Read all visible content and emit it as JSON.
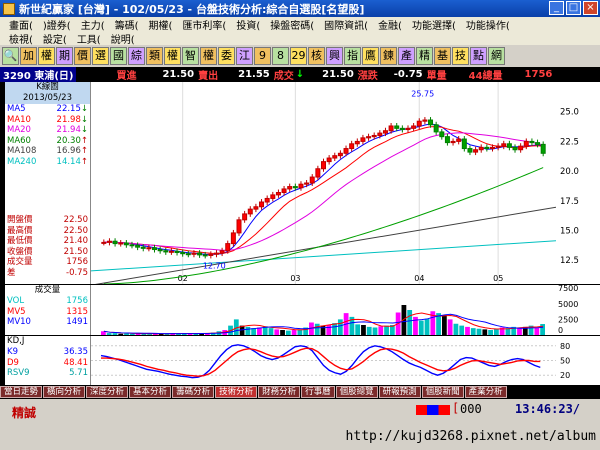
{
  "titlebar": {
    "title": "新世紀贏家 [台灣] - 102/05/23 - 台盤技術分析:綜合自選股[名望股]"
  },
  "menu": {
    "row1": [
      "畫面(",
      ")證券(",
      "主力(",
      "籌碼(",
      "期權(",
      "匯市利率(",
      "投資(",
      "操盤密碼(",
      "國際資訊(",
      "金融(",
      "功能選擇(",
      "功能操作("
    ],
    "row2": [
      "檢視(",
      "設定(",
      "工具(",
      "說明("
    ]
  },
  "toolbar": {
    "items": [
      "🔍",
      "加",
      "權",
      "期",
      "價",
      "選",
      "國",
      "綜",
      "類",
      "權",
      "智",
      "權",
      "委",
      "江",
      "9",
      "8",
      "29",
      "核",
      "興",
      "指",
      "鷹",
      "鍊",
      "產",
      "精",
      "基",
      "技",
      "點",
      "網"
    ]
  },
  "info": {
    "symbol": "3290 東浦(日)",
    "bid_label": "買進",
    "bid": "21.50",
    "ask_label": "賣出",
    "ask": "21.55",
    "deal_label": "成交",
    "deal": "21.50",
    "change_label": "漲跌",
    "change": "-0.75",
    "unit_label": "單量",
    "total_vol_label": "44總量",
    "total_vol": "1756"
  },
  "kpanel": {
    "header": "K線圖",
    "date": "2013/05/23",
    "ma": [
      {
        "name": "MA5",
        "value": "22.15",
        "arrow": "↓",
        "color": "#0000ff"
      },
      {
        "name": "MA10",
        "value": "21.98",
        "arrow": "↓",
        "color": "#ff0000"
      },
      {
        "name": "MA20",
        "value": "21.94",
        "arrow": "↓",
        "color": "#e000e0"
      },
      {
        "name": "MA60",
        "value": "20.30",
        "arrow": "↑",
        "color": "#008000"
      },
      {
        "name": "MA108",
        "value": "16.96",
        "arrow": "↑",
        "color": "#404040"
      },
      {
        "name": "MA240",
        "value": "14.14",
        "arrow": "↑",
        "color": "#00c0c0"
      }
    ],
    "prices": [
      {
        "name": "開盤價",
        "value": "22.50"
      },
      {
        "name": "最高價",
        "value": "22.50"
      },
      {
        "name": "最低價",
        "value": "21.40"
      },
      {
        "name": "收盤價",
        "value": "21.50"
      },
      {
        "name": "成交量",
        "value": "1756"
      },
      {
        "name": "差",
        "value": "-0.75"
      }
    ]
  },
  "volpanel": {
    "header": "成交量",
    "rows": [
      {
        "name": "VOL",
        "value": "1756",
        "color": "#00c0c0"
      },
      {
        "name": "MV5",
        "value": "1315",
        "color": "#ff0000"
      },
      {
        "name": "MV10",
        "value": "1491",
        "color": "#0000ff"
      }
    ]
  },
  "kdpanel": {
    "header": "KD,J",
    "rows": [
      {
        "name": "K9",
        "value": "36.35",
        "color": "#0000ff"
      },
      {
        "name": "D9",
        "value": "48.41",
        "color": "#ff0000"
      },
      {
        "name": "RSV9",
        "value": "5.71",
        "color": "#00a0a0"
      }
    ]
  },
  "chart_data": [
    {
      "type": "candlestick",
      "ylim": [
        10.5,
        27.5
      ],
      "y_ticks": [
        "25.0",
        "22.5",
        "20.0",
        "17.5",
        "15.0",
        "12.5"
      ],
      "x_labels": [
        "02",
        "03",
        "04",
        "05"
      ],
      "high_label": "25.75",
      "low_label": "12.70",
      "closes": [
        14,
        14.1,
        13.9,
        13.95,
        13.8,
        13.75,
        13.6,
        13.5,
        13.55,
        13.4,
        13.3,
        13.2,
        13.25,
        13.15,
        13.05,
        13.0,
        13.1,
        12.95,
        12.9,
        13.0,
        13.1,
        13.3,
        13.9,
        14.8,
        15.9,
        16.4,
        16.8,
        17.0,
        17.4,
        17.7,
        18.0,
        18.2,
        18.5,
        18.7,
        18.6,
        18.9,
        19.0,
        19.5,
        20.2,
        20.8,
        21.1,
        21.3,
        21.5,
        21.9,
        22.3,
        22.5,
        22.8,
        22.9,
        23.0,
        23.2,
        23.4,
        23.8,
        23.6,
        23.5,
        23.6,
        23.8,
        24.2,
        24.3,
        23.9,
        23.3,
        22.9,
        22.4,
        22.5,
        22.7,
        21.9,
        21.6,
        21.8,
        22.0,
        21.9,
        22.0,
        22.1,
        22.3,
        22.0,
        21.8,
        22.1,
        22.5,
        22.4,
        22.25,
        21.5
      ],
      "ma5": [],
      "ma20": [],
      "ma60_line": [
        10.5,
        20.3
      ],
      "ma108_line": [
        10.4,
        16.96
      ],
      "ma240_line": [
        11.6,
        14.14
      ]
    },
    {
      "type": "bar",
      "y_ticks": [
        "7500",
        "5000",
        "2500",
        "0"
      ],
      "ylim": [
        0,
        8000
      ],
      "values": [
        600,
        300,
        300,
        200,
        250,
        200,
        250,
        200,
        150,
        200,
        250,
        200,
        300,
        200,
        250,
        300,
        200,
        300,
        300,
        400,
        600,
        800,
        1500,
        2500,
        1500,
        1300,
        1100,
        1200,
        1400,
        1100,
        900,
        800,
        700,
        800,
        900,
        1200,
        2000,
        1800,
        1500,
        1600,
        1900,
        2500,
        3500,
        2900,
        1700,
        1600,
        1300,
        1200,
        1400,
        1500,
        1600,
        3600,
        4800,
        4000,
        2900,
        2300,
        2600,
        3800,
        3500,
        3200,
        2500,
        1800,
        1500,
        1300,
        1100,
        1000,
        900,
        800,
        1000,
        1200,
        1100,
        1300,
        1200,
        1300,
        1500,
        1200,
        1756
      ]
    },
    {
      "type": "line",
      "y_ticks": [
        "80",
        "50",
        "20"
      ],
      "ylim": [
        0,
        100
      ],
      "k": [
        60,
        58,
        55,
        52,
        48,
        44,
        40,
        36,
        32,
        30,
        28,
        25,
        22,
        20,
        18,
        17,
        15,
        16,
        20,
        30,
        45,
        60,
        72,
        80,
        82,
        80,
        75,
        68,
        60,
        55,
        52,
        55,
        62,
        70,
        78,
        80,
        78,
        70,
        55,
        40,
        30,
        25,
        22,
        28,
        40,
        55,
        68,
        76,
        80,
        78,
        74,
        68,
        60,
        52,
        45,
        40,
        36,
        30,
        24,
        20,
        24,
        32,
        42,
        52,
        56,
        55,
        50,
        45,
        40,
        38,
        42,
        48,
        52,
        54,
        52,
        46,
        40,
        36
      ],
      "d": [
        55,
        55,
        54,
        53,
        51,
        48,
        45,
        42,
        38,
        35,
        32,
        30,
        27,
        25,
        22,
        20,
        19,
        18,
        19,
        23,
        30,
        40,
        50,
        60,
        68,
        72,
        74,
        72,
        68,
        63,
        59,
        57,
        58,
        62,
        67,
        72,
        75,
        74,
        68,
        58,
        48,
        40,
        34,
        31,
        33,
        40,
        48,
        58,
        66,
        72,
        74,
        73,
        70,
        65,
        58,
        52,
        46,
        41,
        36,
        31,
        29,
        30,
        34,
        40,
        45,
        49,
        50,
        48,
        46,
        44,
        42,
        44,
        46,
        49,
        50,
        50,
        48,
        48
      ]
    }
  ],
  "bottomtabs": [
    "當日走勢",
    "橫向分析",
    "深度分析",
    "基本分析",
    "籌碼分析",
    "技術分析",
    "財務分析",
    "行事曆",
    "個股總覽",
    "研報預測",
    "個股新聞",
    "產業分析"
  ],
  "status": {
    "left": "精誠",
    "code": "000",
    "time": "13:46:23/"
  },
  "taskbar": {
    "url": "http://kujd3268.pixnet.net/album"
  }
}
